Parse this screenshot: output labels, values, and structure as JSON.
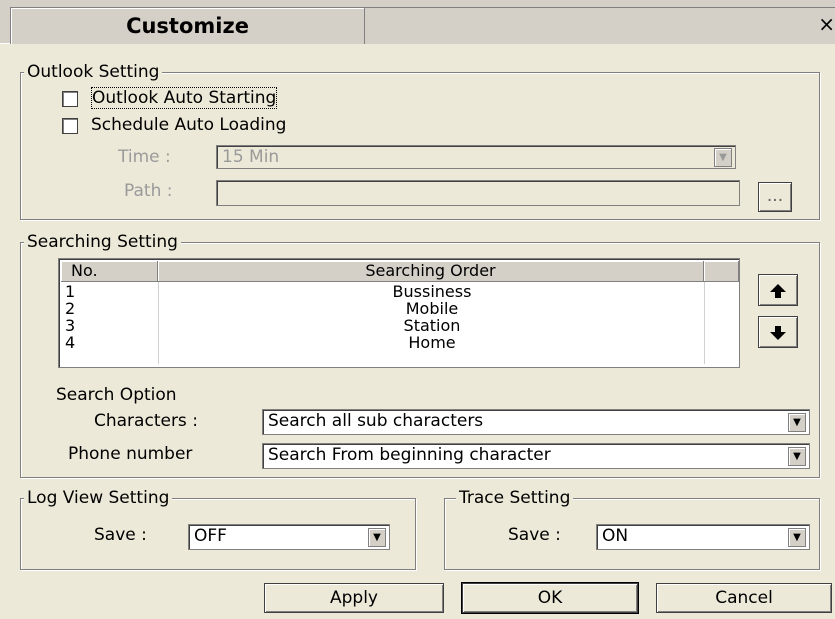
{
  "window": {
    "title": "Customize",
    "close_glyph": "×"
  },
  "outlook": {
    "legend": "Outlook Setting",
    "auto_starting_label": "Outlook Auto Starting",
    "auto_starting_checked": false,
    "schedule_label": "Schedule Auto Loading",
    "schedule_checked": false,
    "time_label": "Time :",
    "time_value": "15 Min",
    "path_label": "Path :",
    "path_value": "",
    "browse_label": "..."
  },
  "searching": {
    "legend": "Searching Setting",
    "columns": [
      "No.",
      "Searching Order"
    ],
    "rows": [
      {
        "no": "1",
        "order": "Bussiness"
      },
      {
        "no": "2",
        "order": "Mobile"
      },
      {
        "no": "3",
        "order": "Station"
      },
      {
        "no": "4",
        "order": "Home"
      }
    ],
    "up_icon": "arrow-up-icon",
    "down_icon": "arrow-down-icon",
    "search_option_label": "Search Option",
    "characters_label": "Characters :",
    "characters_value": "Search all sub characters",
    "phone_label": "Phone number",
    "phone_value": "Search From beginning character"
  },
  "log_view": {
    "legend": "Log View Setting",
    "save_label": "Save :",
    "save_value": "OFF"
  },
  "trace": {
    "legend": "Trace Setting",
    "save_label": "Save :",
    "save_value": "ON"
  },
  "buttons": {
    "apply": "Apply",
    "ok": "OK",
    "cancel": "Cancel"
  }
}
